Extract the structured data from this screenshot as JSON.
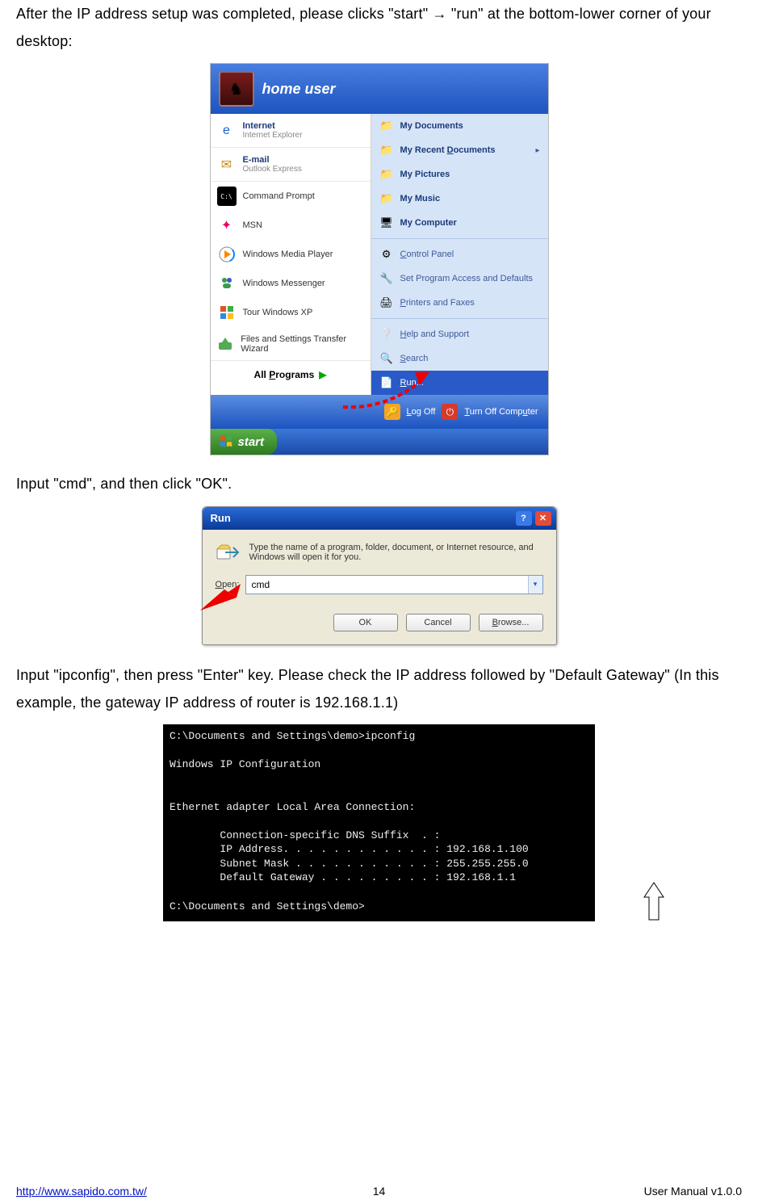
{
  "para1": "After the IP address setup was completed, please clicks \"start\" → \"run\" at the bottom-lower corner of your desktop:",
  "para2": "Input \"cmd\", and then click \"OK\".",
  "para3": "Input \"ipconfig\", then press \"Enter\" key.    Please check the IP address followed by \"Default Gateway\" (In this example, the gateway IP address of router is 192.168.1.1)",
  "start_menu": {
    "user": "home user",
    "left": {
      "internet_title": "Internet",
      "internet_sub": "Internet Explorer",
      "email_title": "E-mail",
      "email_sub": "Outlook Express",
      "cmd": "Command Prompt",
      "msn": "MSN",
      "wmp": "Windows Media Player",
      "wm": "Windows Messenger",
      "tour": "Tour Windows XP",
      "fst": "Files and Settings Transfer Wizard",
      "all_prefix": "All ",
      "all_p": "P",
      "all_suffix": "rograms"
    },
    "right": {
      "my_docs": "My Documents",
      "my_recent_prefix": "My Recent ",
      "my_recent_d": "D",
      "my_recent_suffix": "ocuments",
      "my_pics": "My Pictures",
      "my_music": "My Music",
      "my_comp": "My Computer",
      "ctrl_panel_c": "C",
      "ctrl_panel_suffix": "ontrol Panel",
      "set_prog": "Set Program Access and Defaults",
      "printers_p": "P",
      "printers_suffix": "rinters and Faxes",
      "help_h": "H",
      "help_suffix": "elp and Support",
      "search_s": "S",
      "search_suffix": "earch",
      "run_r": "R",
      "run_suffix": "un..."
    },
    "footer": {
      "logoff_l": "L",
      "logoff_suffix": "og Off",
      "turnoff": "Turn Off Computer",
      "turnoff_t": "T",
      "turnoff_mid": "urn Off Comp",
      "turnoff_u": "u",
      "turnoff_end": "ter"
    },
    "start_button": "start"
  },
  "run_dialog": {
    "title": "Run",
    "desc": "Type the name of a program, folder, document, or Internet resource, and Windows will open it for you.",
    "open_label_o": "O",
    "open_label_suffix": "pen:",
    "input_value": "cmd",
    "ok": "OK",
    "cancel": "Cancel",
    "browse_b": "B",
    "browse_suffix": "rowse..."
  },
  "cmd_window": {
    "l1": "C:\\Documents and Settings\\demo>ipconfig",
    "l2": "Windows IP Configuration",
    "l3": "Ethernet adapter Local Area Connection:",
    "l4": "        Connection-specific DNS Suffix  . :",
    "l5": "        IP Address. . . . . . . . . . . . : 192.168.1.100",
    "l6": "        Subnet Mask . . . . . . . . . . . : 255.255.255.0",
    "l7": "        Default Gateway . . . . . . . . . : 192.168.1.1",
    "l8": "C:\\Documents and Settings\\demo>"
  },
  "footer": {
    "url": "http://www.sapido.com.tw/",
    "page": "14",
    "right": "User Manual v1.0.0"
  }
}
